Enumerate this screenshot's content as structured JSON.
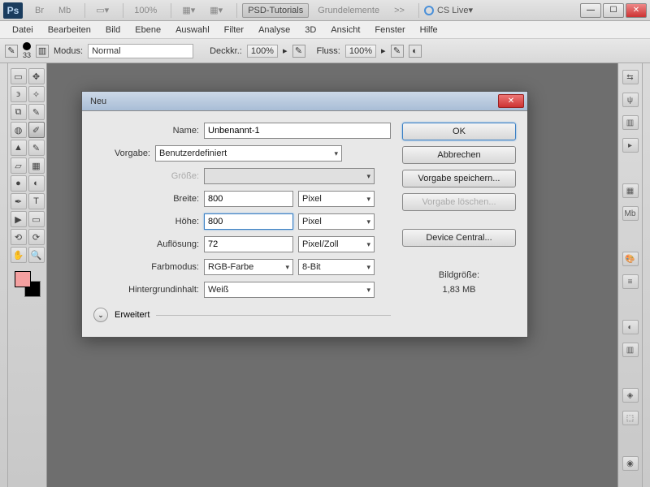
{
  "topbar": {
    "zoom": "100%",
    "tabs": [
      "PSD-Tutorials",
      "Grundelemente"
    ],
    "more": ">>",
    "cslive": "CS Live"
  },
  "menu": [
    "Datei",
    "Bearbeiten",
    "Bild",
    "Ebene",
    "Auswahl",
    "Filter",
    "Analyse",
    "3D",
    "Ansicht",
    "Fenster",
    "Hilfe"
  ],
  "optbar": {
    "brush_size": "33",
    "modus_label": "Modus:",
    "modus_value": "Normal",
    "opacity_label": "Deckkr.:",
    "opacity_value": "100%",
    "flow_label": "Fluss:",
    "flow_value": "100%"
  },
  "dialog": {
    "title": "Neu",
    "name_label": "Name:",
    "name_value": "Unbenannt-1",
    "preset_label": "Vorgabe:",
    "preset_value": "Benutzerdefiniert",
    "size_label": "Größe:",
    "width_label": "Breite:",
    "width_value": "800",
    "width_unit": "Pixel",
    "height_label": "Höhe:",
    "height_value": "800",
    "height_unit": "Pixel",
    "res_label": "Auflösung:",
    "res_value": "72",
    "res_unit": "Pixel/Zoll",
    "colormode_label": "Farbmodus:",
    "colormode_value": "RGB-Farbe",
    "colordepth_value": "8-Bit",
    "bg_label": "Hintergrundinhalt:",
    "bg_value": "Weiß",
    "advanced": "Erweitert",
    "imagesize_label": "Bildgröße:",
    "imagesize_value": "1,83 MB",
    "btn_ok": "OK",
    "btn_cancel": "Abbrechen",
    "btn_save_preset": "Vorgabe speichern...",
    "btn_delete_preset": "Vorgabe löschen...",
    "btn_device_central": "Device Central..."
  }
}
